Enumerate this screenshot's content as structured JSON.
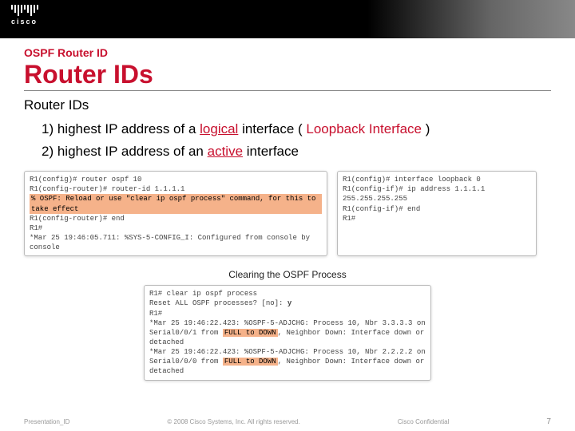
{
  "brand": "cisco",
  "kicker": "OSPF Router ID",
  "title": "Router IDs",
  "subtitle": "Router IDs",
  "bullets": {
    "b1_prefix": "1) highest IP address of a ",
    "b1_red": "logical",
    "b1_mid": " interface ( ",
    "b1_loop": "Loopback Interface",
    "b1_suffix": " )",
    "b2_prefix": "2) highest IP address of an ",
    "b2_red": "active",
    "b2_suffix": " interface"
  },
  "term1": {
    "l1": "R1(config)# router ospf 10",
    "l2": "R1(config-router)# router-id 1.1.1.1",
    "hl": "% OSPF: Reload or use \"clear ip ospf process\" command, for this to take effect",
    "l4": "R1(config-router)# end",
    "l5": "R1#",
    "l6": "*Mar 25 19:46:05.711: %SYS-5-CONFIG_I: Configured from console by console"
  },
  "term2": {
    "l1": "R1(config)# interface loopback 0",
    "l2": "R1(config-if)# ip address 1.1.1.1 255.255.255.255",
    "l3": "R1(config-if)# end",
    "l4": "R1#"
  },
  "section2_label": "Clearing the OSPF Process",
  "term3": {
    "l1": "R1# clear ip ospf process",
    "l2a": "Reset ALL OSPF processes? [no]: ",
    "l2b": "y",
    "l3": "R1#",
    "l4a": "*Mar 25 19:46:22.423: %OSPF-5-ADJCHG: Process 10, Nbr 3.3.3.3 on Serial0/0/1 from ",
    "l4b": "FULL to DOWN",
    "l4c": ", Neighbor Down: Interface down or detached",
    "l5a": "*Mar 25 19:46:22.423: %OSPF-5-ADJCHG: Process 10, Nbr 2.2.2.2 on Serial0/0/0 from ",
    "l5b": "FULL to DOWN",
    "l5c": ", Neighbor Down: Interface down or detached"
  },
  "footer": {
    "left": "Presentation_ID",
    "mid": "© 2008 Cisco Systems, Inc. All rights reserved.",
    "right": "Cisco Confidential",
    "page": "7"
  }
}
